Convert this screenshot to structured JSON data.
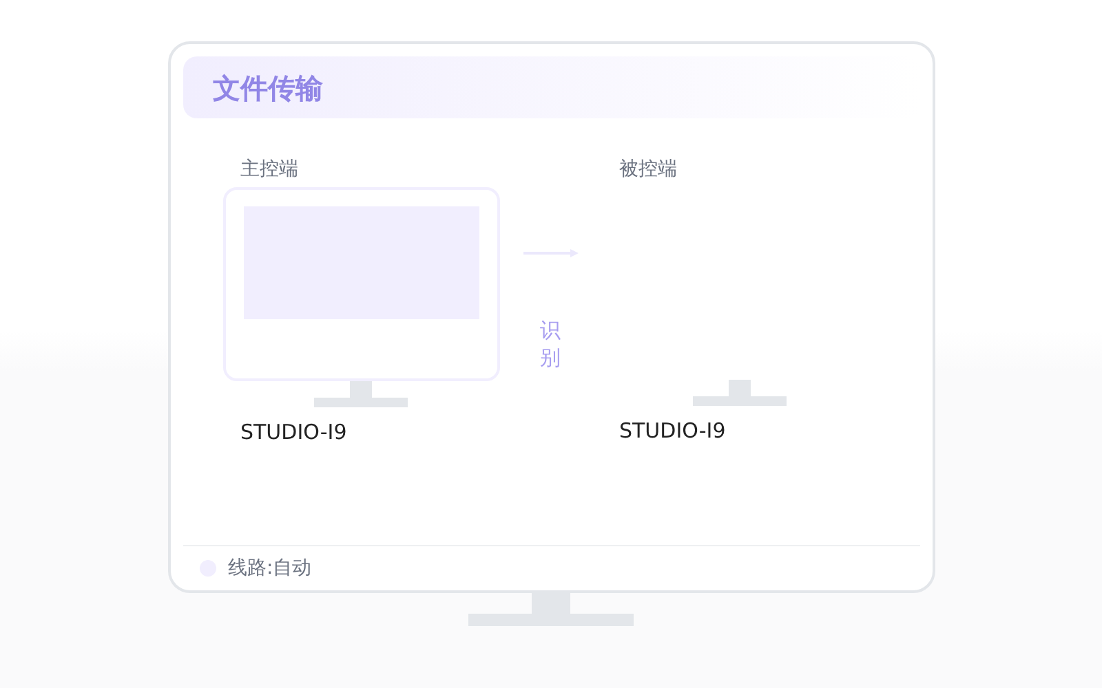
{
  "window": {
    "title": "文件传输"
  },
  "devices": [
    {
      "role": "主控端",
      "name": "STUDIO-I9",
      "kind": "monitor"
    },
    {
      "role": "被控端",
      "name": "STUDIO-I9",
      "kind": "stand"
    }
  ],
  "link": {
    "label": "识别"
  },
  "status": {
    "text": "线路:自动",
    "color": "#f1eefe"
  }
}
